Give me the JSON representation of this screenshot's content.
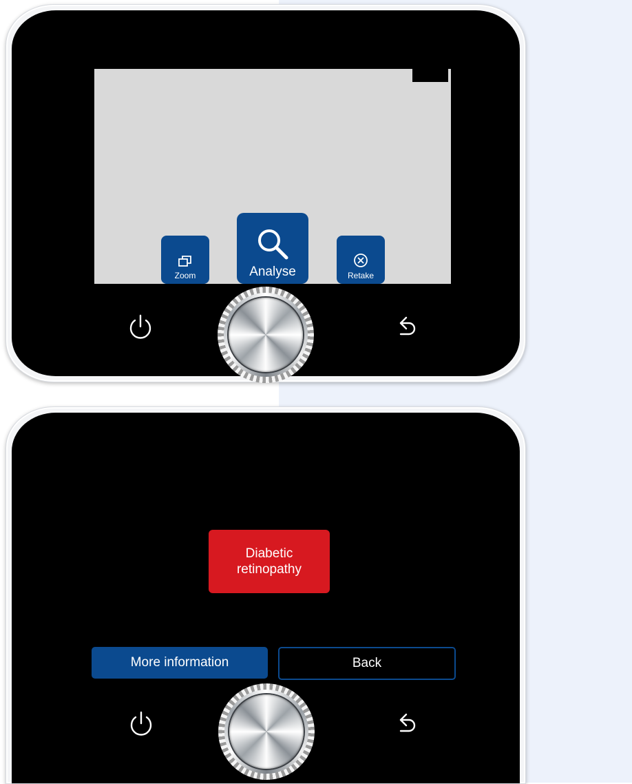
{
  "screen1": {
    "buttons": {
      "zoom": {
        "label": "Zoom",
        "icon": "windows-icon"
      },
      "analyse": {
        "label": "Analyse",
        "icon": "magnifier-icon"
      },
      "retake": {
        "label": "Retake",
        "icon": "close-circle-icon"
      }
    }
  },
  "screen2": {
    "diagnosis": {
      "line1": "Diabetic",
      "line2": "retinopathy",
      "color": "#d71920"
    },
    "buttons": {
      "more_info": "More information",
      "back": "Back"
    }
  },
  "hardware": {
    "power_icon": "power-icon",
    "back_icon": "return-arrow-icon",
    "knob": "rotary-knob"
  },
  "colors": {
    "accent_blue": "#0b4a8f",
    "bezel": "#000000",
    "preview_gray": "#d9d9d9",
    "background_panel": "#edf2fb"
  }
}
